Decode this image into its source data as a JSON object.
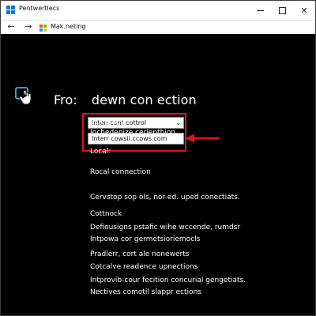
{
  "window": {
    "title": "Pentwertlecs",
    "controls": {
      "minimize": "—",
      "maximize": "☐",
      "close": "✕"
    }
  },
  "nav": {
    "back": "←",
    "forward": "→",
    "page_title": "Mak.neting",
    "logo_colors": [
      "#f25022",
      "#7fba00",
      "#00a4ef",
      "#ffb900"
    ]
  },
  "main": {
    "icon": "hand-pointer-icon",
    "heading_prefix": "Fro:",
    "heading": "dewn con ection",
    "dropdown": {
      "selected": "Inten cont cottrol"
    },
    "host_field": {
      "value": "Interr cowsil.ccows.com"
    },
    "section1_title": "Scibecftly:",
    "section1_text": "Inchedenize cerienthion",
    "section2_title": "Local:",
    "section3_title": "Rocal connection",
    "info_text": "Cervstop sop ols, nor-ed. uped conectiats.",
    "list_title": "Cottnock",
    "items": [
      "Defiousigns pstafic wihe wccende, rumdsr",
      "Intpowa cor germetsioriemocls",
      "Pradlerr, cort ale nonewerts",
      "Cotcalve readence upnections",
      "Intprovib-cour fecition concurial gengetiats.",
      "Nectives comotil slappr ections"
    ]
  },
  "colors": {
    "highlight": "#e0141e",
    "background": "#000000",
    "titlebar": "#ffffff",
    "accent": "#0a78d4"
  }
}
